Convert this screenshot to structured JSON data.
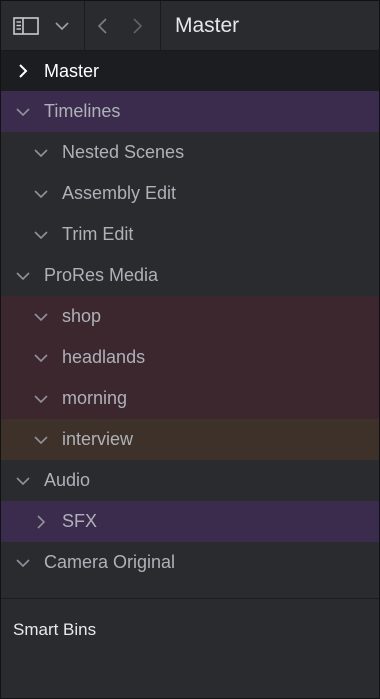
{
  "header": {
    "title": "Master",
    "sidebar_icon": "sidebar-toggle-icon",
    "dropdown_icon": "chevron-down-icon",
    "back_icon": "chevron-left-icon",
    "forward_icon": "chevron-right-icon"
  },
  "tree": {
    "master": "Master",
    "timelines": "Timelines",
    "nested_scenes": "Nested Scenes",
    "assembly_edit": "Assembly Edit",
    "trim_edit": "Trim Edit",
    "prores_media": "ProRes Media",
    "shop": "shop",
    "headlands": "headlands",
    "morning": "morning",
    "interview": "interview",
    "audio": "Audio",
    "sfx": "SFX",
    "camera_original": "Camera Original"
  },
  "smart_bins": {
    "label": "Smart Bins"
  },
  "colors": {
    "purple_bin": "#3b2c4e",
    "red_bin": "#3c272e",
    "orange_bin": "#3e3129",
    "selected": "#1c1d20"
  }
}
